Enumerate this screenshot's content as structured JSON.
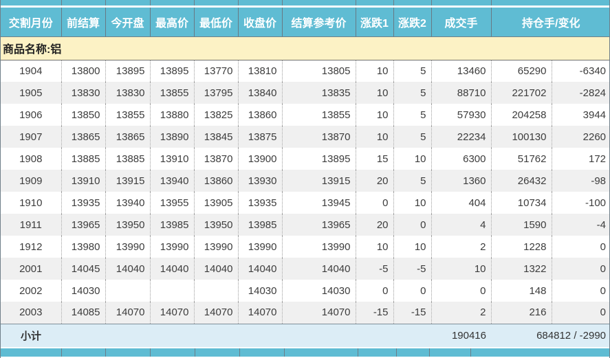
{
  "colors": {
    "header_bg": "#5fbcd3",
    "header_text": "#ffffff",
    "product_row_bg": "#fcf2c5",
    "row_stripe_bg": "#f0f0f0",
    "subtotal_row_bg": "#dcedf6",
    "grid_line": "#9a9a9a"
  },
  "table": {
    "columns": [
      "交割月份",
      "前结算",
      "今开盘",
      "最高价",
      "最低价",
      "收盘价",
      "结算参考价",
      "涨跌1",
      "涨跌2",
      "成交手",
      "持仓手/变化"
    ],
    "product_label": "商品名称:铝",
    "rows": [
      {
        "month": "1904",
        "prev_settle": "13800",
        "open": "13895",
        "high": "13895",
        "low": "13770",
        "close": "13810",
        "settle_ref": "13805",
        "change1": "10",
        "change2": "5",
        "volume": "13460",
        "open_interest": "65290",
        "oi_change": "-6340"
      },
      {
        "month": "1905",
        "prev_settle": "13830",
        "open": "13830",
        "high": "13855",
        "low": "13795",
        "close": "13840",
        "settle_ref": "13835",
        "change1": "10",
        "change2": "5",
        "volume": "88710",
        "open_interest": "221702",
        "oi_change": "-2824"
      },
      {
        "month": "1906",
        "prev_settle": "13850",
        "open": "13855",
        "high": "13880",
        "low": "13825",
        "close": "13860",
        "settle_ref": "13855",
        "change1": "10",
        "change2": "5",
        "volume": "57930",
        "open_interest": "204258",
        "oi_change": "3944"
      },
      {
        "month": "1907",
        "prev_settle": "13865",
        "open": "13865",
        "high": "13890",
        "low": "13845",
        "close": "13875",
        "settle_ref": "13870",
        "change1": "10",
        "change2": "5",
        "volume": "22234",
        "open_interest": "100130",
        "oi_change": "2260"
      },
      {
        "month": "1908",
        "prev_settle": "13885",
        "open": "13885",
        "high": "13910",
        "low": "13870",
        "close": "13900",
        "settle_ref": "13895",
        "change1": "15",
        "change2": "10",
        "volume": "6300",
        "open_interest": "51762",
        "oi_change": "172"
      },
      {
        "month": "1909",
        "prev_settle": "13910",
        "open": "13915",
        "high": "13940",
        "low": "13860",
        "close": "13930",
        "settle_ref": "13915",
        "change1": "20",
        "change2": "5",
        "volume": "1360",
        "open_interest": "26432",
        "oi_change": "-98"
      },
      {
        "month": "1910",
        "prev_settle": "13935",
        "open": "13940",
        "high": "13955",
        "low": "13905",
        "close": "13935",
        "settle_ref": "13945",
        "change1": "0",
        "change2": "10",
        "volume": "404",
        "open_interest": "10734",
        "oi_change": "-100"
      },
      {
        "month": "1911",
        "prev_settle": "13965",
        "open": "13950",
        "high": "13985",
        "low": "13950",
        "close": "13985",
        "settle_ref": "13965",
        "change1": "20",
        "change2": "0",
        "volume": "4",
        "open_interest": "1590",
        "oi_change": "-4"
      },
      {
        "month": "1912",
        "prev_settle": "13980",
        "open": "13990",
        "high": "13990",
        "low": "13990",
        "close": "13990",
        "settle_ref": "13990",
        "change1": "10",
        "change2": "10",
        "volume": "2",
        "open_interest": "1228",
        "oi_change": "0"
      },
      {
        "month": "2001",
        "prev_settle": "14045",
        "open": "14040",
        "high": "14040",
        "low": "14040",
        "close": "14040",
        "settle_ref": "14040",
        "change1": "-5",
        "change2": "-5",
        "volume": "10",
        "open_interest": "1322",
        "oi_change": "0"
      },
      {
        "month": "2002",
        "prev_settle": "14030",
        "open": "",
        "high": "",
        "low": "",
        "close": "14030",
        "settle_ref": "14030",
        "change1": "0",
        "change2": "0",
        "volume": "0",
        "open_interest": "148",
        "oi_change": "0"
      },
      {
        "month": "2003",
        "prev_settle": "14085",
        "open": "14070",
        "high": "14070",
        "low": "14070",
        "close": "14070",
        "settle_ref": "14070",
        "change1": "-15",
        "change2": "-15",
        "volume": "2",
        "open_interest": "216",
        "oi_change": "0"
      }
    ],
    "subtotal": {
      "label": "小计",
      "volume_total": "190416",
      "open_interest_total": "684812 / -2990"
    }
  }
}
